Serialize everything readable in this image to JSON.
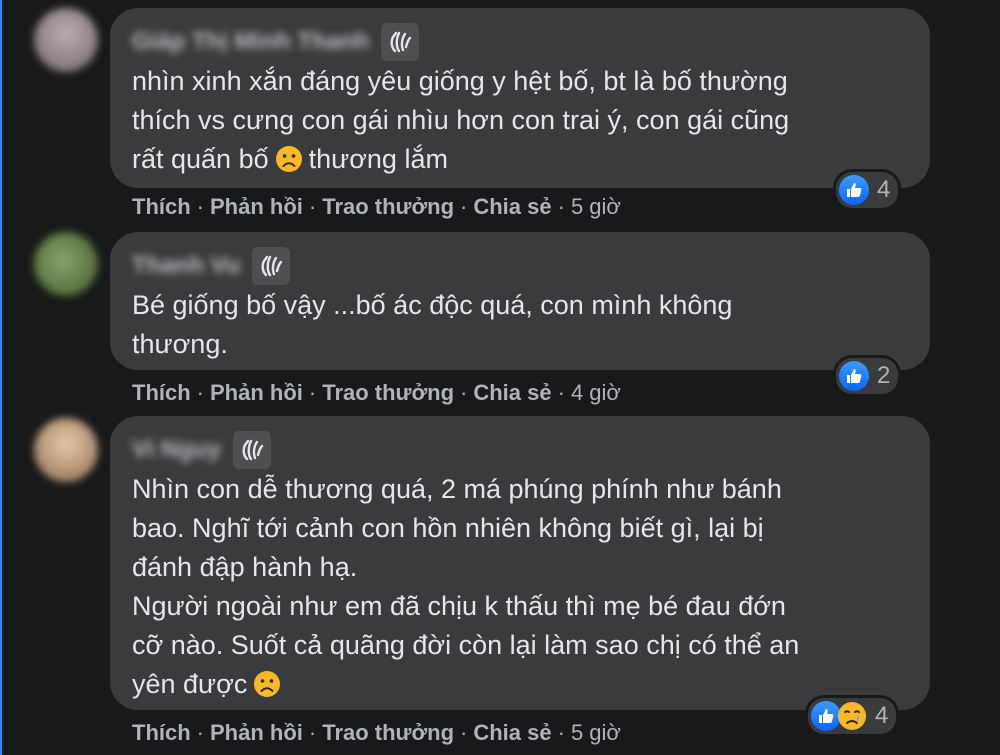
{
  "comments": [
    {
      "author": "Giáp Thị Minh Thanh",
      "text": "nhìn xinh xắn đáng yêu giống y hệt bố, bt là bố thường\nthích vs cưng con gái nhìu hơn con trai ý, con gái cũng\nrất quấn bố",
      "text_after": "thương lắm",
      "reaction_count": "4",
      "time": "5 giờ",
      "reactions": [
        "like-icon"
      ],
      "avatar_color": "#8a7f80"
    },
    {
      "author": "Thanh Vu",
      "text": "Bé giống bố vậy ...bố ác độc quá, con mình không\nthương.",
      "text_after": "",
      "reaction_count": "2",
      "time": "4 giờ",
      "reactions": [
        "like-icon"
      ],
      "avatar_color": "#5f7a45"
    },
    {
      "author": "Vi Nguy",
      "text": "Nhìn con dễ thương quá, 2 má phúng phính như bánh\nbao. Nghĩ tới cảnh con hồn nhiên không biết gì, lại bị\nđánh đập hành hạ.\nNgười ngoài như em đã chịu k thấu thì mẹ bé đau đớn\ncỡ nào. Suốt cả quãng đời còn lại làm sao chị có thể an\nyên được",
      "text_after": "",
      "reaction_count": "4",
      "time": "5 giờ",
      "reactions": [
        "like-icon",
        "sad-icon"
      ],
      "avatar_color": "#c9a787"
    }
  ],
  "actions": {
    "like": "Thích",
    "reply": "Phản hồi",
    "reward": "Trao thưởng",
    "share": "Chia sẻ",
    "dot": "·"
  },
  "colors": {
    "background": "#18191a",
    "bubble": "#3a3b3c",
    "text": "#e4e6eb",
    "meta": "#b0b3b8",
    "like_blue": "#0866ff",
    "accent_rule": "#2d88ff"
  },
  "icons": [
    "wave-badge-icon",
    "frown-emoji-icon",
    "like-icon",
    "sad-icon"
  ]
}
